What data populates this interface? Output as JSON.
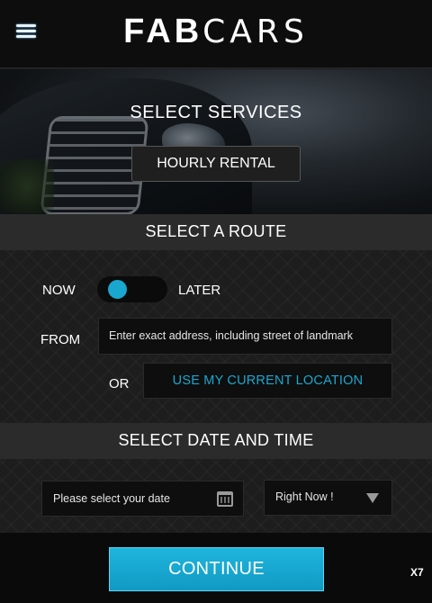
{
  "header": {
    "logo_bold": "FAB",
    "logo_light": "CARS",
    "menu_icon": "hamburger-menu-icon"
  },
  "hero": {
    "title": "SELECT SERVICES",
    "service_button": "HOURLY RENTAL"
  },
  "route": {
    "title": "SELECT A ROUTE",
    "now_label": "NOW",
    "later_label": "LATER",
    "from_label": "FROM",
    "from_placeholder": "Enter exact address, including street of landmark",
    "or_label": "OR",
    "current_location_button": "USE MY CURRENT LOCATION"
  },
  "datetime": {
    "title": "SELECT DATE AND TIME",
    "date_placeholder": "Please select your date",
    "calendar_icon": "calendar-icon",
    "time_value": "Right Now !",
    "dropdown_icon": "chevron-down-icon"
  },
  "footer": {
    "continue_button": "CONTINUE",
    "badge": "X7"
  },
  "colors": {
    "accent": "#1aa7cf",
    "background": "#1c1c1c",
    "header": "#0d0d0d"
  }
}
